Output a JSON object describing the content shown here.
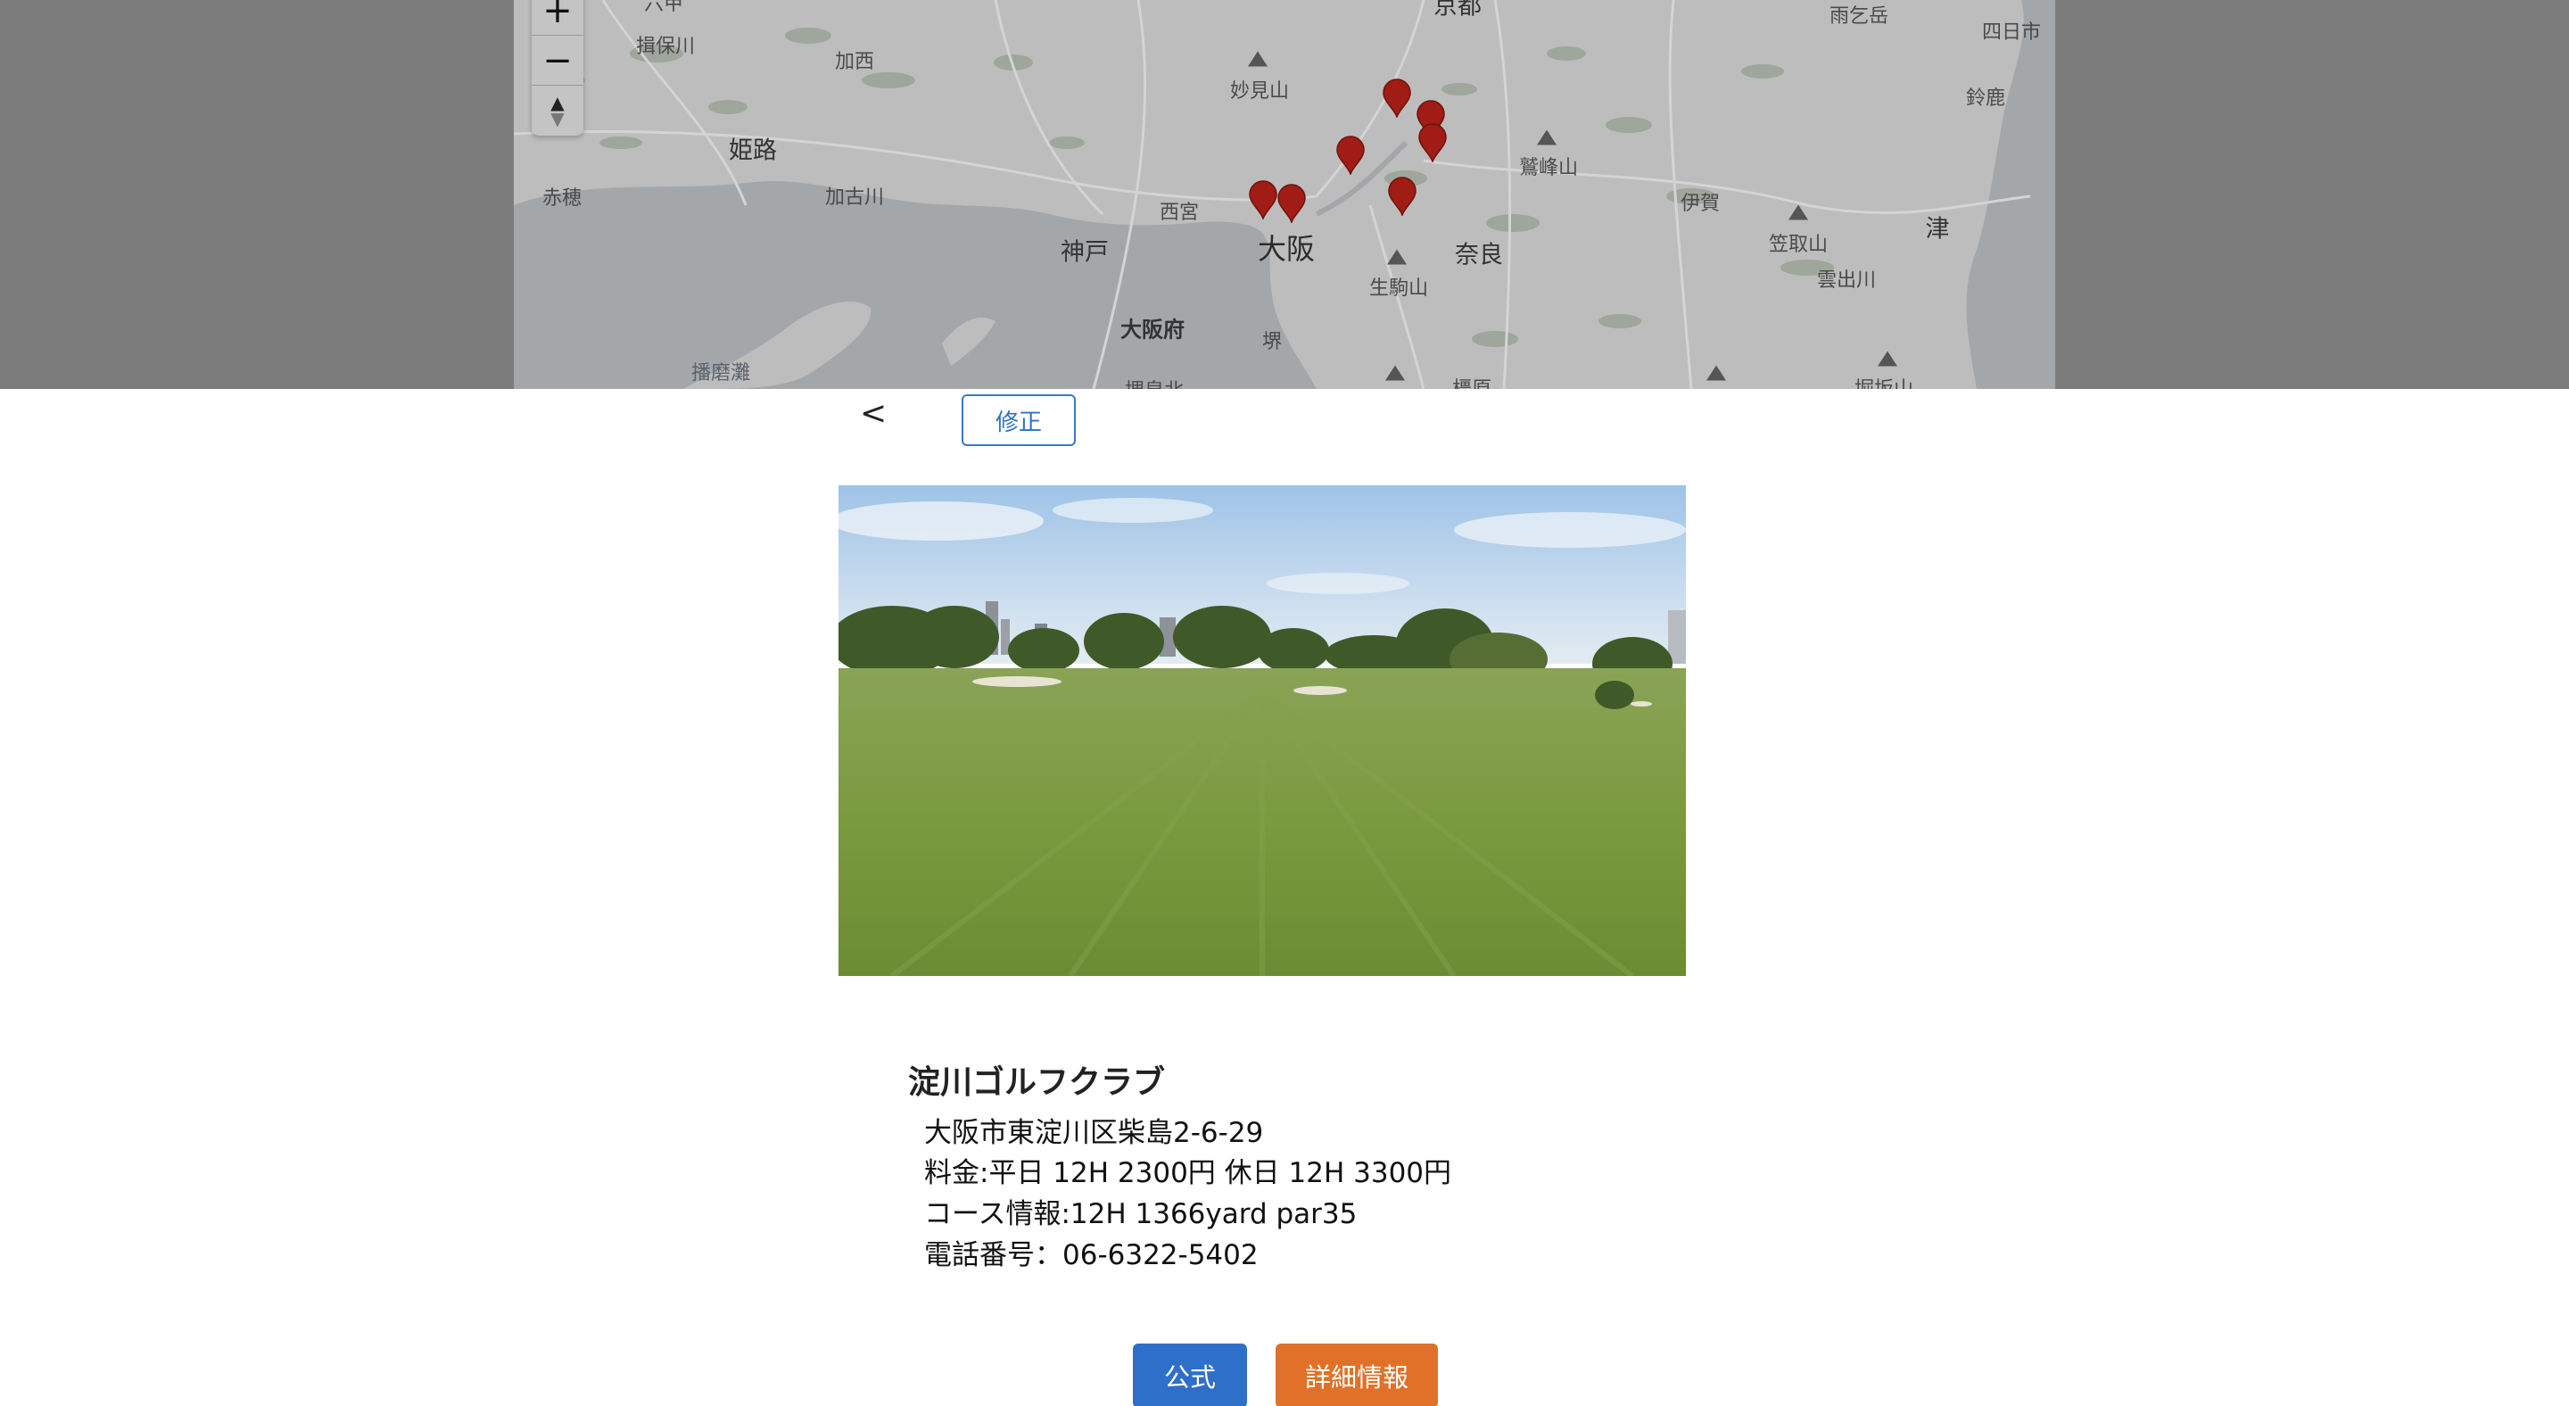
{
  "map": {
    "zoom_in_label": "+",
    "zoom_out_label": "−",
    "compass_label": "▲",
    "place_labels": {
      "rokko": "六甲",
      "ibogawa": "揖保川",
      "kasai": "加西",
      "himeji": "姫路",
      "ako": "赤穂",
      "kakogawa_city": "加古川",
      "kobe": "神戸",
      "nishinomiya": "西宮",
      "osaka": "大阪",
      "osaka_pref": "大阪府",
      "sakai": "堺",
      "nara": "奈良",
      "ikoma": "生駒山",
      "harima_nada": "播磨灘",
      "kyoto": "京都",
      "myokenzan": "妙見山",
      "washimine": "鷲峰山",
      "iga": "伊賀",
      "amagoi": "雨乞岳",
      "yokkaichi": "四日市",
      "suzuka": "鈴鹿",
      "tsu": "津",
      "kasatori": "笠取山",
      "kumozugawa": "雲出川",
      "kashihara": "橿原",
      "horisaka": "堀坂山",
      "kitaizumi": "堺泉北"
    },
    "pin_color": "#a01c14"
  },
  "panel": {
    "back_label": "<",
    "edit_label": "修正",
    "course_name": "淀川ゴルフクラブ",
    "address": "大阪市東淀川区柴島2-6-29",
    "fee": "料金:平日 12H 2300円 休日 12H 3300円",
    "course_info": "コース情報:12H 1366yard par35",
    "phone": "電話番号：06-6322-5402",
    "official_label": "公式",
    "details_label": "詳細情報",
    "colors": {
      "official": "#2e6fc9",
      "details": "#e17128",
      "edit_border": "#3b78c9"
    }
  }
}
